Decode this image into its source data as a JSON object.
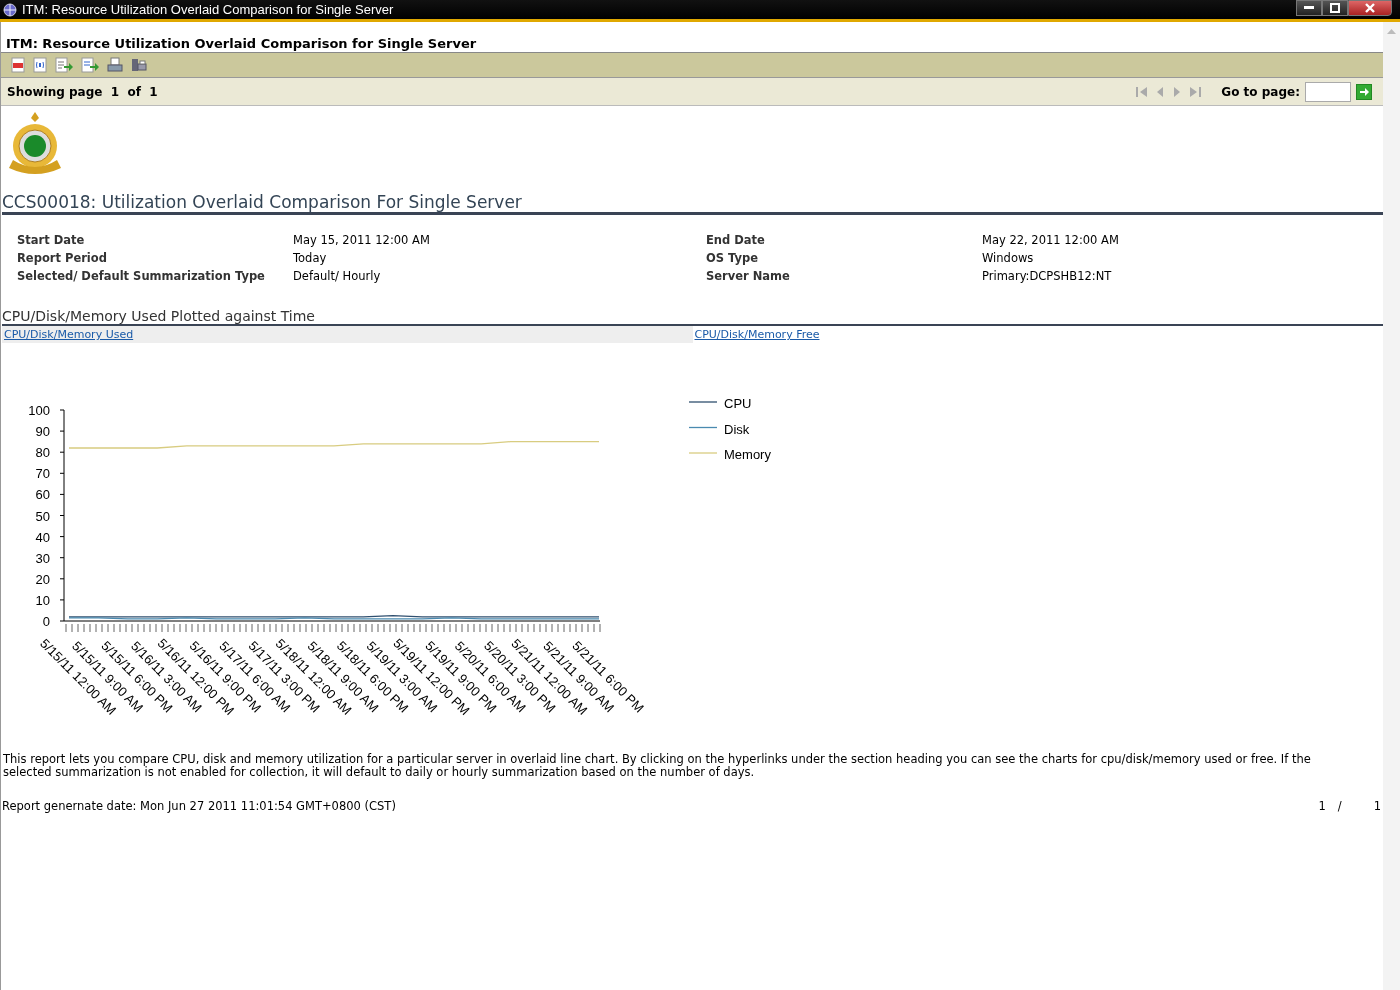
{
  "window": {
    "title": "ITM: Resource Utilization Overlaid Comparison for Single Server"
  },
  "frame_title": "ITM: Resource Utilization Overlaid Comparison for Single Server",
  "navigation": {
    "showing": "Showing page",
    "page": "1",
    "of": "of",
    "total": "1",
    "goto_label": "Go to page:"
  },
  "report": {
    "title": "CCS00018: Utilization Overlaid Comparison For Single Server",
    "parameters": [
      {
        "label": "Start Date",
        "value": "May 15, 2011 12:00 AM"
      },
      {
        "label": "End Date",
        "value": "May 22, 2011 12:00 AM"
      },
      {
        "label": "Report Period",
        "value": "Today"
      },
      {
        "label": "OS Type",
        "value": "Windows"
      },
      {
        "label": "Selected/ Default Summarization Type",
        "value": "Default/ Hourly"
      },
      {
        "label": "Server Name",
        "value": "Primary:DCPSHB12:NT"
      }
    ],
    "section_title": "CPU/Disk/Memory Used Plotted against Time",
    "tabs": [
      {
        "label": "CPU/Disk/Memory Used",
        "selected": true
      },
      {
        "label": "CPU/Disk/Memory Free",
        "selected": false
      }
    ],
    "chart_data": {
      "type": "line",
      "categories": [
        "5/15/11 12:00 AM",
        "5/15/11 9:00 AM",
        "5/15/11 6:00 PM",
        "5/16/11 3:00 AM",
        "5/16/11 12:00 PM",
        "5/16/11 9:00 PM",
        "5/17/11 6:00 AM",
        "5/17/11 3:00 PM",
        "5/18/11 12:00 AM",
        "5/18/11 9:00 AM",
        "5/18/11 6:00 PM",
        "5/19/11 3:00 AM",
        "5/19/11 12:00 PM",
        "5/19/11 9:00 PM",
        "5/20/11 6:00 AM",
        "5/20/11 3:00 PM",
        "5/21/11 12:00 AM",
        "5/21/11 9:00 AM",
        "5/21/11 6:00 PM"
      ],
      "ylim": [
        0,
        100
      ],
      "legend": "right",
      "yticks": [
        0,
        10,
        20,
        30,
        40,
        50,
        60,
        70,
        80,
        90,
        100
      ],
      "series": [
        {
          "name": "CPU",
          "color": "#2f4f6f",
          "values": [
            2,
            2,
            2,
            2,
            2,
            2,
            2,
            2,
            2,
            2,
            2,
            2.5,
            2,
            2,
            2,
            2,
            2,
            2,
            2
          ]
        },
        {
          "name": "Disk",
          "color": "#4a8ab0",
          "values": [
            1.5,
            1.5,
            1,
            1,
            1.5,
            1,
            1,
            1,
            1.5,
            1,
            1,
            1,
            1,
            1.5,
            1,
            1,
            1,
            1,
            1
          ]
        },
        {
          "name": "Memory",
          "color": "#d8cc80",
          "values": [
            82,
            82,
            82,
            82,
            83,
            83,
            83,
            83,
            83,
            83,
            84,
            84,
            84,
            84,
            84,
            85,
            85,
            85,
            85
          ]
        }
      ]
    },
    "description": "This report lets you compare CPU, disk and memory utilization for a particular server in overlaid line chart. By clicking on the hyperlinks under the section heading you can see the charts for cpu/disk/memory used or free. If the selected summarization is not enabled for collection, it will default to daily or hourly summarization based on the number of days.",
    "generated": "Report genernate date:  Mon Jun 27 2011 11:01:54 GMT+0800 (CST)",
    "page_footer": {
      "page": "1",
      "separator": "/",
      "total": "1"
    }
  }
}
